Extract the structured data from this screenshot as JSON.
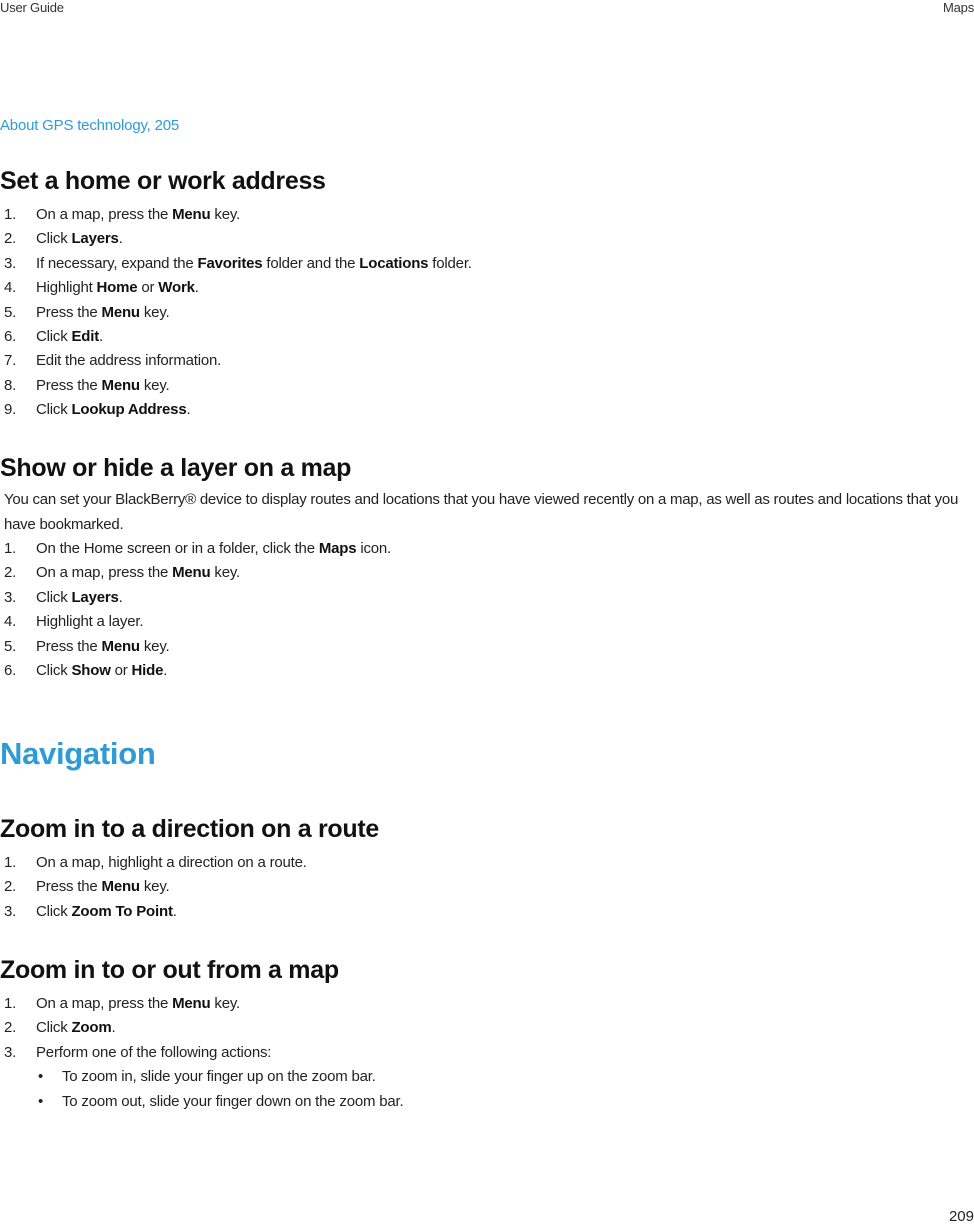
{
  "header": {
    "left": "User Guide",
    "right": "Maps"
  },
  "related_link": "About GPS technology, 205",
  "sections": {
    "set_home": {
      "title": "Set a home or work address",
      "steps": [
        {
          "n": "1.",
          "parts": [
            {
              "t": "On a map, press the "
            },
            {
              "b": "Menu"
            },
            {
              "t": " key."
            }
          ]
        },
        {
          "n": "2.",
          "parts": [
            {
              "t": "Click "
            },
            {
              "b": "Layers"
            },
            {
              "t": "."
            }
          ]
        },
        {
          "n": "3.",
          "parts": [
            {
              "t": "If necessary, expand the "
            },
            {
              "b": "Favorites"
            },
            {
              "t": " folder and the "
            },
            {
              "b": "Locations"
            },
            {
              "t": " folder."
            }
          ]
        },
        {
          "n": "4.",
          "parts": [
            {
              "t": "Highlight "
            },
            {
              "b": "Home"
            },
            {
              "t": " or "
            },
            {
              "b": "Work"
            },
            {
              "t": "."
            }
          ]
        },
        {
          "n": "5.",
          "parts": [
            {
              "t": "Press the "
            },
            {
              "b": "Menu"
            },
            {
              "t": " key."
            }
          ]
        },
        {
          "n": "6.",
          "parts": [
            {
              "t": "Click "
            },
            {
              "b": "Edit"
            },
            {
              "t": "."
            }
          ]
        },
        {
          "n": "7.",
          "parts": [
            {
              "t": "Edit the address information."
            }
          ]
        },
        {
          "n": "8.",
          "parts": [
            {
              "t": "Press the "
            },
            {
              "b": "Menu"
            },
            {
              "t": " key."
            }
          ]
        },
        {
          "n": "9.",
          "parts": [
            {
              "t": "Click "
            },
            {
              "b": "Lookup Address"
            },
            {
              "t": "."
            }
          ]
        }
      ]
    },
    "show_layer": {
      "title": "Show or hide a layer on a map",
      "intro": "You can set your BlackBerry® device to display routes and locations that you have viewed recently on a map, as well as routes and locations that you have bookmarked.",
      "steps": [
        {
          "n": "1.",
          "parts": [
            {
              "t": "On the Home screen or in a folder, click the "
            },
            {
              "b": "Maps"
            },
            {
              "t": " icon."
            }
          ]
        },
        {
          "n": "2.",
          "parts": [
            {
              "t": "On a map, press the "
            },
            {
              "b": "Menu"
            },
            {
              "t": " key."
            }
          ]
        },
        {
          "n": "3.",
          "parts": [
            {
              "t": "Click "
            },
            {
              "b": "Layers"
            },
            {
              "t": "."
            }
          ]
        },
        {
          "n": "4.",
          "parts": [
            {
              "t": "Highlight a layer."
            }
          ]
        },
        {
          "n": "5.",
          "parts": [
            {
              "t": "Press the "
            },
            {
              "b": "Menu"
            },
            {
              "t": " key."
            }
          ]
        },
        {
          "n": "6.",
          "parts": [
            {
              "t": "Click "
            },
            {
              "b": "Show"
            },
            {
              "t": " or "
            },
            {
              "b": "Hide"
            },
            {
              "t": "."
            }
          ]
        }
      ]
    },
    "navigation": {
      "title": "Navigation"
    },
    "zoom_direction": {
      "title": "Zoom in to a direction on a route",
      "steps": [
        {
          "n": "1.",
          "parts": [
            {
              "t": "On a map, highlight a direction on a route."
            }
          ]
        },
        {
          "n": "2.",
          "parts": [
            {
              "t": "Press the "
            },
            {
              "b": "Menu"
            },
            {
              "t": " key."
            }
          ]
        },
        {
          "n": "3.",
          "parts": [
            {
              "t": "Click "
            },
            {
              "b": "Zoom To Point"
            },
            {
              "t": "."
            }
          ]
        }
      ]
    },
    "zoom_map": {
      "title": "Zoom in to or out from a map",
      "steps": [
        {
          "n": "1.",
          "parts": [
            {
              "t": "On a map, press the "
            },
            {
              "b": "Menu"
            },
            {
              "t": " key."
            }
          ]
        },
        {
          "n": "2.",
          "parts": [
            {
              "t": "Click "
            },
            {
              "b": "Zoom"
            },
            {
              "t": "."
            }
          ]
        },
        {
          "n": "3.",
          "parts": [
            {
              "t": "Perform one of the following actions:"
            }
          ]
        }
      ],
      "bullets": [
        "To zoom in, slide your finger up on the zoom bar.",
        "To zoom out, slide your finger down on the zoom bar."
      ],
      "bullet_glyph": "•"
    }
  },
  "page_number": "209",
  "colors": {
    "accent": "#2e9bd6",
    "text": "#222222"
  }
}
